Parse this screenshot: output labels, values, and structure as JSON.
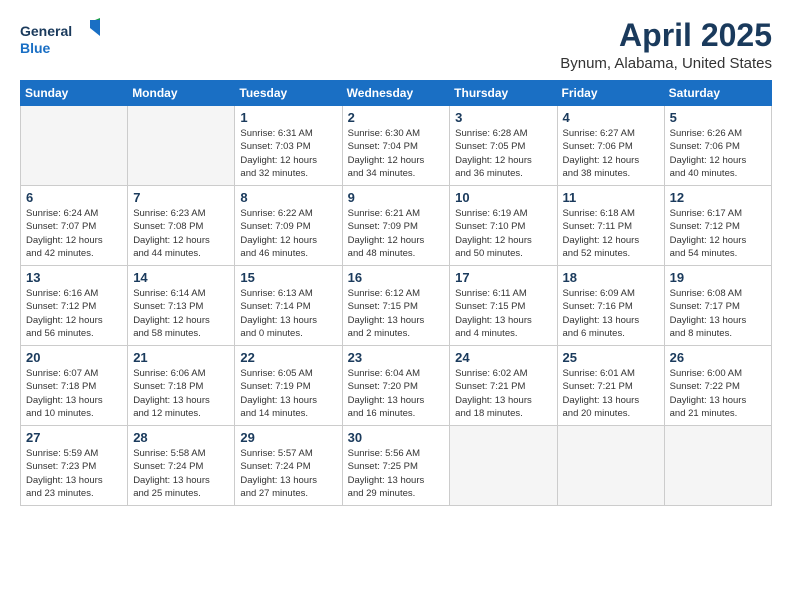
{
  "header": {
    "logo": {
      "line1": "General",
      "line2": "Blue"
    },
    "title": "April 2025",
    "location": "Bynum, Alabama, United States"
  },
  "weekdays": [
    "Sunday",
    "Monday",
    "Tuesday",
    "Wednesday",
    "Thursday",
    "Friday",
    "Saturday"
  ],
  "weeks": [
    [
      {
        "day": "",
        "empty": true
      },
      {
        "day": "",
        "empty": true
      },
      {
        "day": "1",
        "info": "Sunrise: 6:31 AM\nSunset: 7:03 PM\nDaylight: 12 hours\nand 32 minutes."
      },
      {
        "day": "2",
        "info": "Sunrise: 6:30 AM\nSunset: 7:04 PM\nDaylight: 12 hours\nand 34 minutes."
      },
      {
        "day": "3",
        "info": "Sunrise: 6:28 AM\nSunset: 7:05 PM\nDaylight: 12 hours\nand 36 minutes."
      },
      {
        "day": "4",
        "info": "Sunrise: 6:27 AM\nSunset: 7:06 PM\nDaylight: 12 hours\nand 38 minutes."
      },
      {
        "day": "5",
        "info": "Sunrise: 6:26 AM\nSunset: 7:06 PM\nDaylight: 12 hours\nand 40 minutes."
      }
    ],
    [
      {
        "day": "6",
        "info": "Sunrise: 6:24 AM\nSunset: 7:07 PM\nDaylight: 12 hours\nand 42 minutes."
      },
      {
        "day": "7",
        "info": "Sunrise: 6:23 AM\nSunset: 7:08 PM\nDaylight: 12 hours\nand 44 minutes."
      },
      {
        "day": "8",
        "info": "Sunrise: 6:22 AM\nSunset: 7:09 PM\nDaylight: 12 hours\nand 46 minutes."
      },
      {
        "day": "9",
        "info": "Sunrise: 6:21 AM\nSunset: 7:09 PM\nDaylight: 12 hours\nand 48 minutes."
      },
      {
        "day": "10",
        "info": "Sunrise: 6:19 AM\nSunset: 7:10 PM\nDaylight: 12 hours\nand 50 minutes."
      },
      {
        "day": "11",
        "info": "Sunrise: 6:18 AM\nSunset: 7:11 PM\nDaylight: 12 hours\nand 52 minutes."
      },
      {
        "day": "12",
        "info": "Sunrise: 6:17 AM\nSunset: 7:12 PM\nDaylight: 12 hours\nand 54 minutes."
      }
    ],
    [
      {
        "day": "13",
        "info": "Sunrise: 6:16 AM\nSunset: 7:12 PM\nDaylight: 12 hours\nand 56 minutes."
      },
      {
        "day": "14",
        "info": "Sunrise: 6:14 AM\nSunset: 7:13 PM\nDaylight: 12 hours\nand 58 minutes."
      },
      {
        "day": "15",
        "info": "Sunrise: 6:13 AM\nSunset: 7:14 PM\nDaylight: 13 hours\nand 0 minutes."
      },
      {
        "day": "16",
        "info": "Sunrise: 6:12 AM\nSunset: 7:15 PM\nDaylight: 13 hours\nand 2 minutes."
      },
      {
        "day": "17",
        "info": "Sunrise: 6:11 AM\nSunset: 7:15 PM\nDaylight: 13 hours\nand 4 minutes."
      },
      {
        "day": "18",
        "info": "Sunrise: 6:09 AM\nSunset: 7:16 PM\nDaylight: 13 hours\nand 6 minutes."
      },
      {
        "day": "19",
        "info": "Sunrise: 6:08 AM\nSunset: 7:17 PM\nDaylight: 13 hours\nand 8 minutes."
      }
    ],
    [
      {
        "day": "20",
        "info": "Sunrise: 6:07 AM\nSunset: 7:18 PM\nDaylight: 13 hours\nand 10 minutes."
      },
      {
        "day": "21",
        "info": "Sunrise: 6:06 AM\nSunset: 7:18 PM\nDaylight: 13 hours\nand 12 minutes."
      },
      {
        "day": "22",
        "info": "Sunrise: 6:05 AM\nSunset: 7:19 PM\nDaylight: 13 hours\nand 14 minutes."
      },
      {
        "day": "23",
        "info": "Sunrise: 6:04 AM\nSunset: 7:20 PM\nDaylight: 13 hours\nand 16 minutes."
      },
      {
        "day": "24",
        "info": "Sunrise: 6:02 AM\nSunset: 7:21 PM\nDaylight: 13 hours\nand 18 minutes."
      },
      {
        "day": "25",
        "info": "Sunrise: 6:01 AM\nSunset: 7:21 PM\nDaylight: 13 hours\nand 20 minutes."
      },
      {
        "day": "26",
        "info": "Sunrise: 6:00 AM\nSunset: 7:22 PM\nDaylight: 13 hours\nand 21 minutes."
      }
    ],
    [
      {
        "day": "27",
        "info": "Sunrise: 5:59 AM\nSunset: 7:23 PM\nDaylight: 13 hours\nand 23 minutes."
      },
      {
        "day": "28",
        "info": "Sunrise: 5:58 AM\nSunset: 7:24 PM\nDaylight: 13 hours\nand 25 minutes."
      },
      {
        "day": "29",
        "info": "Sunrise: 5:57 AM\nSunset: 7:24 PM\nDaylight: 13 hours\nand 27 minutes."
      },
      {
        "day": "30",
        "info": "Sunrise: 5:56 AM\nSunset: 7:25 PM\nDaylight: 13 hours\nand 29 minutes."
      },
      {
        "day": "",
        "empty": true
      },
      {
        "day": "",
        "empty": true
      },
      {
        "day": "",
        "empty": true
      }
    ]
  ]
}
